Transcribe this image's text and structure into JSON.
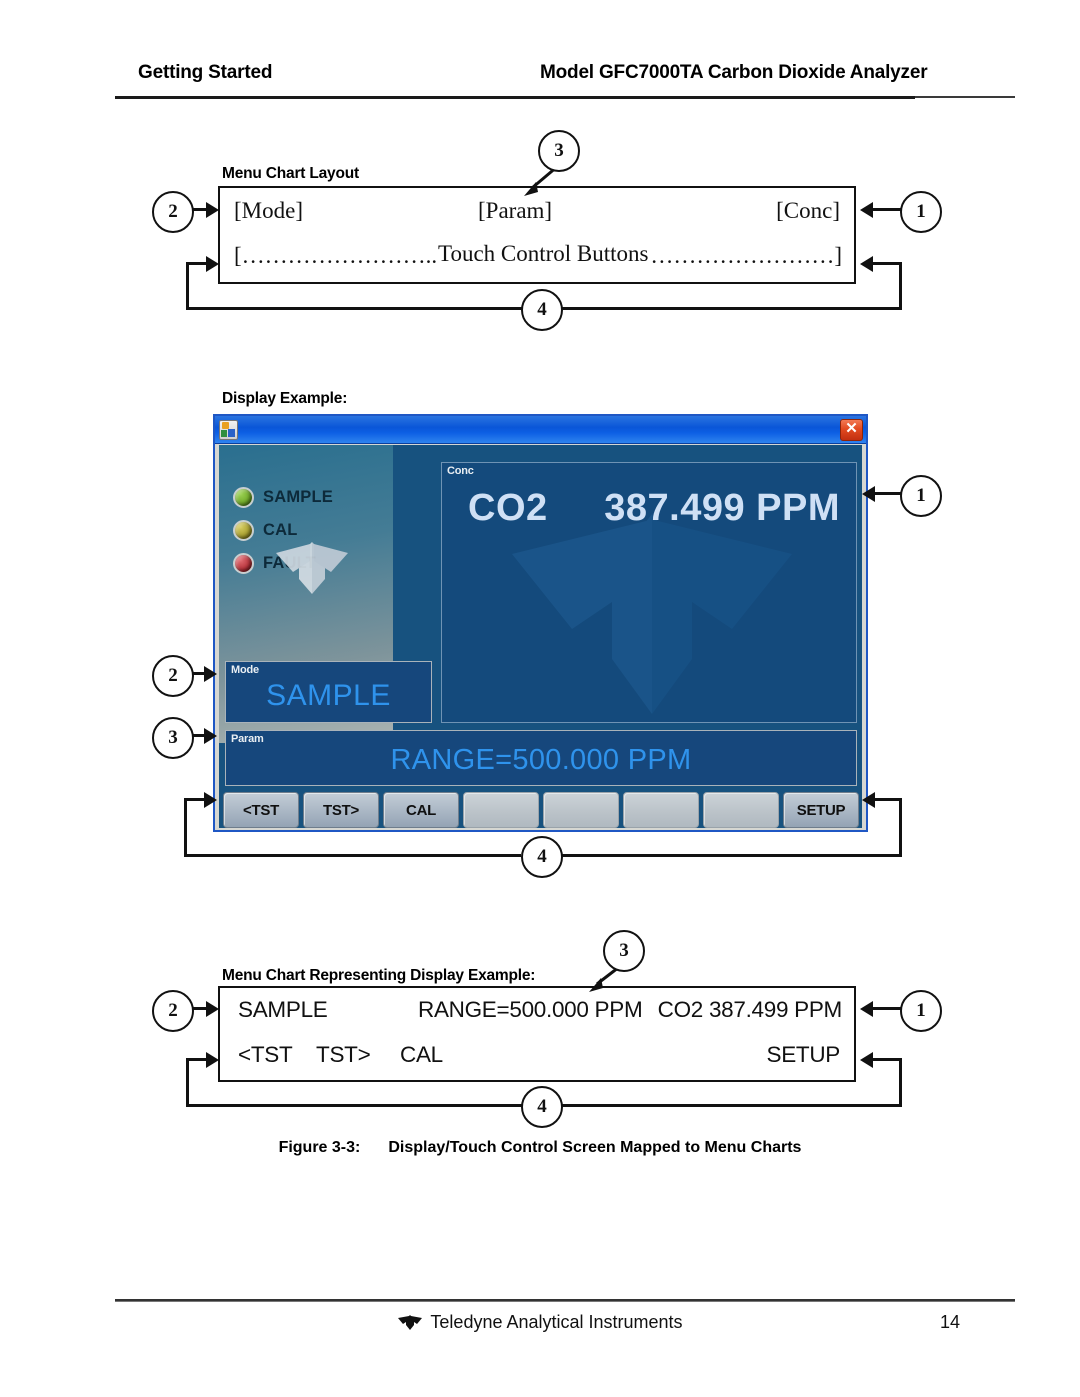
{
  "header": {
    "left": "Getting Started",
    "right": "Model GFC7000TA Carbon Dioxide Analyzer"
  },
  "top_chart": {
    "label": "Menu Chart Layout",
    "row1": {
      "mode": "[Mode]",
      "param": "[Param]",
      "conc": "[Conc]"
    },
    "row2": {
      "left_dots": "[……………………..",
      "center": "Touch Control Buttons",
      "right_dots": "……………………]"
    },
    "callouts": {
      "one": "1",
      "two": "2",
      "three": "3",
      "four": "4"
    }
  },
  "display_example": {
    "label": "Display Example:",
    "titlebar": {
      "icon": "app-icon",
      "close": "✕"
    },
    "status_leds": [
      {
        "name": "SAMPLE",
        "color": "#6fa828"
      },
      {
        "name": "CAL",
        "color": "#a39a2c"
      },
      {
        "name": "FAULT",
        "color": "#b33038"
      }
    ],
    "mode_panel": {
      "tag": "Mode",
      "value": "SAMPLE"
    },
    "conc_panel": {
      "tag": "Conc",
      "gas": "CO2",
      "value": "387.499 PPM"
    },
    "param_panel": {
      "tag": "Param",
      "value": "RANGE=500.000 PPM"
    },
    "buttons": [
      {
        "label": "<TST",
        "blank": false
      },
      {
        "label": "TST>",
        "blank": false
      },
      {
        "label": "CAL",
        "blank": false
      },
      {
        "label": "",
        "blank": true
      },
      {
        "label": "",
        "blank": true
      },
      {
        "label": "",
        "blank": true
      },
      {
        "label": "",
        "blank": true
      },
      {
        "label": "SETUP",
        "blank": false
      }
    ],
    "callouts": {
      "one": "1",
      "two": "2",
      "three": "3",
      "four": "4"
    }
  },
  "bottom_chart": {
    "label": "Menu Chart Representing Display Example:",
    "row1": {
      "mode": "SAMPLE",
      "param": "RANGE=500.000 PPM",
      "conc": "CO2 387.499 PPM"
    },
    "row2": {
      "b1": "<TST",
      "b2": "TST>",
      "b3": "CAL",
      "b4": "SETUP"
    },
    "callouts": {
      "one": "1",
      "two": "2",
      "three": "3",
      "four": "4"
    }
  },
  "caption": {
    "number": "Figure 3-3:",
    "text": "Display/Touch Control Screen Mapped to Menu Charts"
  },
  "footer": {
    "company": "Teledyne Analytical Instruments",
    "page": "14"
  }
}
